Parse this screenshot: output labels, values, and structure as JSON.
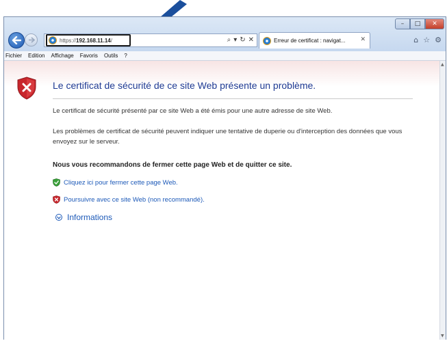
{
  "browser": {
    "url_prefix": "https://",
    "url_host": "192.168.11.14",
    "url_suffix": "/",
    "address_tools": {
      "search": "⌕",
      "dropdown": "▾",
      "refresh": "↻",
      "stop": "✕"
    },
    "tab_title": "Erreur de certificat : navigat...",
    "tab_close": "✕",
    "window_controls": {
      "minimize": "–",
      "maximize": "□",
      "close": "✕"
    },
    "right_tools": {
      "home": "⌂",
      "favorites": "☆",
      "settings": "⚙"
    }
  },
  "menu": {
    "items": [
      "Fichier",
      "Edition",
      "Affichage",
      "Favoris",
      "Outils",
      "?"
    ]
  },
  "page": {
    "heading": "Le certificat de sécurité de ce site Web présente un problème.",
    "para1": "Le certificat de sécurité présenté par ce site Web a été émis pour une autre adresse de site Web.",
    "para2": "Les problèmes de certificat de sécurité peuvent indiquer une tentative de duperie ou d'interception des données que vous envoyez sur le serveur.",
    "recommendation": "Nous vous recommandons de fermer cette page Web et de quitter ce site.",
    "close_link": "Cliquez ici pour fermer cette page Web.",
    "continue_link": "Poursuivre avec ce site Web (non recommandé).",
    "info_link": "Informations"
  },
  "colors": {
    "link": "#1c59b8",
    "heading": "#1f3a93",
    "arrow": "#1b4f9c",
    "shield_red": "#c8262c",
    "shield_green": "#3aa03a"
  }
}
